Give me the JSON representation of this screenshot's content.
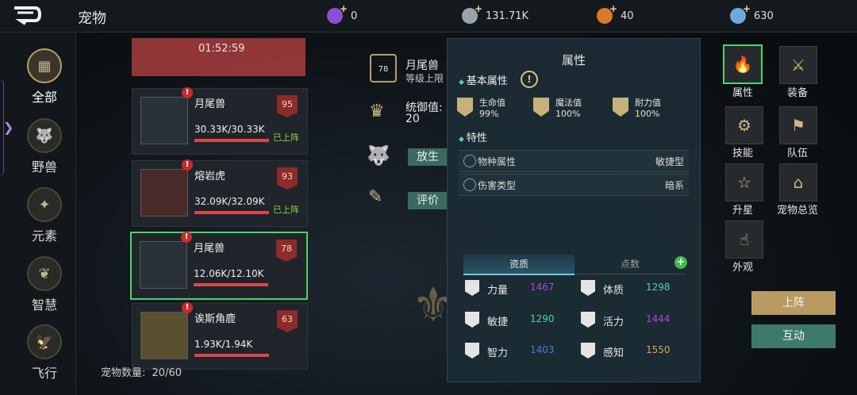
{
  "header": {
    "title": "宠物",
    "resources": [
      {
        "icon": "purple-gem-icon",
        "value": "0",
        "color": "#8a4fd6"
      },
      {
        "icon": "silver-coin-icon",
        "value": "131.71K",
        "color": "#9aa3aa"
      },
      {
        "icon": "orange-coin-icon",
        "value": "40",
        "color": "#d9782a"
      },
      {
        "icon": "blue-crystal-icon",
        "value": "630",
        "color": "#6fa8dc"
      }
    ]
  },
  "sidebar": {
    "items": [
      {
        "label": "全部",
        "icon": "grid-icon",
        "active": true
      },
      {
        "label": "野兽",
        "icon": "beast-icon"
      },
      {
        "label": "元素",
        "icon": "element-icon"
      },
      {
        "label": "智慧",
        "icon": "wisdom-icon"
      },
      {
        "label": "飞行",
        "icon": "flying-icon"
      }
    ]
  },
  "pets": {
    "top_timer": "01:52:59",
    "items": [
      {
        "name": "月尾兽",
        "hp": "30.33K/30.33K",
        "hp_ratio": 1.0,
        "level": "95",
        "status": "已上阵"
      },
      {
        "name": "熔岩虎",
        "hp": "32.09K/32.09K",
        "hp_ratio": 1.0,
        "level": "93",
        "status": "已上阵"
      },
      {
        "name": "月尾兽",
        "hp": "12.06K/12.10K",
        "hp_ratio": 0.997,
        "level": "78",
        "status": ""
      },
      {
        "name": "诶斯角鹿",
        "hp": "1.93K/1.94K",
        "hp_ratio": 0.995,
        "level": "63",
        "status": ""
      }
    ],
    "count_label": "宠物数量:",
    "count_value": "20/60"
  },
  "detail": {
    "level": "78",
    "name": "月尾兽",
    "level_cap": "等级上限",
    "command_label": "统御值:",
    "command_value": "20",
    "release_label": "放生",
    "rate_label": "评价"
  },
  "attributes": {
    "title": "属性",
    "basic_section": "基本属性",
    "basic": [
      {
        "label": "生命值",
        "value": "99%"
      },
      {
        "label": "魔法值",
        "value": "100%"
      },
      {
        "label": "耐力值",
        "value": "100%"
      }
    ],
    "trait_section": "特性",
    "traits": [
      {
        "label": "物种属性",
        "value": "敏捷型"
      },
      {
        "label": "伤害类型",
        "value": "暗系"
      }
    ],
    "tabs": [
      "资质",
      "点数"
    ],
    "stats": [
      {
        "label": "力量",
        "value": "1467",
        "color": "#a24bd6"
      },
      {
        "label": "体质",
        "value": "1298",
        "color": "#4fd3a0"
      },
      {
        "label": "敏捷",
        "value": "1290",
        "color": "#4fd3a0"
      },
      {
        "label": "活力",
        "value": "1444",
        "color": "#a24bd6"
      },
      {
        "label": "智力",
        "value": "1403",
        "color": "#4b7bd6"
      },
      {
        "label": "感知",
        "value": "1550",
        "color": "#d9a84a"
      }
    ]
  },
  "right_menu": {
    "items": [
      {
        "label": "属性",
        "icon": "flame-icon"
      },
      {
        "label": "装备",
        "icon": "swords-icon"
      },
      {
        "label": "技能",
        "icon": "skill-icon"
      },
      {
        "label": "队伍",
        "icon": "flag-icon"
      },
      {
        "label": "升星",
        "icon": "star-icon"
      },
      {
        "label": "宠物总览",
        "icon": "overview-icon"
      },
      {
        "label": "外观",
        "icon": "hand-icon"
      }
    ],
    "deploy_label": "上阵",
    "interact_label": "互动"
  }
}
